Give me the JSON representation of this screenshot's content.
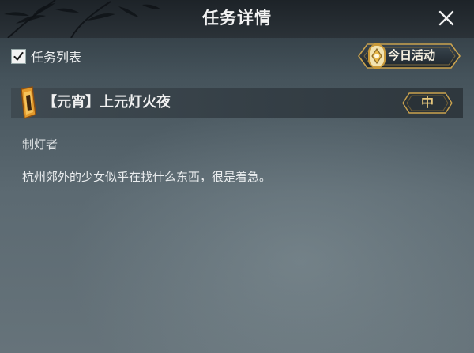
{
  "window": {
    "title": "任务详情"
  },
  "task_list": {
    "label": "任务列表",
    "checked": true
  },
  "today_activity": {
    "label": "今日活动"
  },
  "quest": {
    "title": "【元宵】上元灯火夜",
    "difficulty": "中",
    "npc": "制灯者",
    "description": "杭州郊外的少女似乎在找什么东西，很是着急。"
  },
  "colors": {
    "accent_gold": "#d9a441",
    "difficulty_text": "#e7c87c",
    "title_bar": "#1d2328"
  }
}
